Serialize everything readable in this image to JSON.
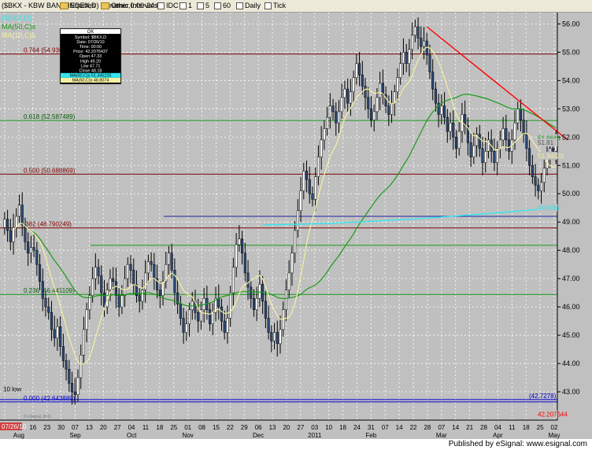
{
  "toolbar": {
    "symbol": "($BKX - KBW BANK INDEX,D) Dynamic,0:00-24:00",
    "items": [
      "Equities",
      "Other Intervals",
      "IDC",
      "1",
      "5",
      "60",
      "Daily",
      "Tick"
    ]
  },
  "footer": {
    "published": "Published by eSignal: www.esignal.com"
  },
  "colors": {
    "background": "#c0c0c0",
    "up": "#ffffff",
    "down": "#2a4a7a",
    "ma10": "#f5f0a0",
    "ma50": "#1a9a1a",
    "ma200": "#33e6f0",
    "trend": "#ff0000",
    "fib": "#800000",
    "grid": "#ffffff",
    "price": "#ffffff"
  },
  "legend": {
    "header": "($BKX,D)",
    "ma_lines": [
      "MA(50,C)s",
      "MA(10,C)s"
    ]
  },
  "info_box": {
    "title": "OK",
    "rows": [
      "Symbol: $BKX,D",
      "Date: 07/26/10",
      "Time: 00:00",
      "Price: 42.2076437",
      "Open 47.33",
      "High 49.20",
      "Low 47.71",
      "Close 48.18",
      "MA(50,C)s 51.345225",
      "MA(50,C)s 48.8074"
    ]
  },
  "chart_data": {
    "type": "candlestick",
    "title": "($BKX - KBW BANK INDEX,D) Dynamic,0:00-24:00",
    "ylim": [
      42,
      56.4
    ],
    "yticks": [
      "56.00",
      "55.00",
      "54.00",
      "53.00",
      "52.00",
      "51.00",
      "50.00",
      "49.00",
      "48.00",
      "47.00",
      "46.00",
      "45.00",
      "44.00",
      "43.00"
    ],
    "x_day_labels": [
      "26",
      "09",
      "16",
      "23",
      "30",
      "07",
      "13",
      "20",
      "27",
      "04",
      "11",
      "18",
      "25",
      "01",
      "08",
      "15",
      "22",
      "29",
      "06",
      "13",
      "20",
      "27",
      "03",
      "10",
      "18",
      "24",
      "31",
      "07",
      "14",
      "22",
      "28",
      "07",
      "14",
      "21",
      "28",
      "04",
      "11",
      "18",
      "25",
      "02"
    ],
    "x_date_label": "07/26/10",
    "x_month_labels": [
      "Aug",
      "Sep",
      "Oct",
      "Nov",
      "Dec",
      "2011",
      "Feb",
      "Mar",
      "Apr",
      "May"
    ],
    "fib_levels": [
      {
        "label": "0.764 (54.936",
        "price": 54.936,
        "color": "#800000"
      },
      {
        "label": "0.618 (52.587489)",
        "price": 52.587,
        "color": "#1a9a1a"
      },
      {
        "label": "0.500 (50.688869)",
        "price": 50.689,
        "color": "#800000"
      },
      {
        "label": ".382 (48.790249)",
        "price": 48.79,
        "color": "#800000"
      },
      {
        "label": "0.236 (46.441109)",
        "price": 46.441,
        "color": "#1a9a1a"
      },
      {
        "label": "0.000 (42.643889)",
        "price": 42.644,
        "color": "#0000cc"
      }
    ],
    "support_lines": [
      {
        "price": 48.18,
        "color": "#1a9a1a"
      },
      {
        "price": 49.2,
        "color": "#2222aa"
      },
      {
        "price": 42.7278,
        "color": "#0000cc",
        "label": "(42.7278)"
      }
    ],
    "right_labels": [
      {
        "text": "51.9644",
        "price": 51.96,
        "color": "#1a9a1a"
      },
      {
        "text": "51.81",
        "price": 51.81,
        "color": "#555555"
      },
      {
        "text": "51.34522",
        "price": 51.345,
        "color": "#f5f0a0"
      },
      {
        "text": "49.5067",
        "price": 49.51,
        "color": "#33e6f0"
      },
      {
        "text": "42.207644",
        "price": 42.207,
        "color": "#ff0000"
      }
    ],
    "annotation_low": "10 low",
    "trendline": {
      "from": {
        "bar": 144,
        "price": 55.9
      },
      "to": {
        "bar": 200,
        "price": 51.9
      }
    },
    "closes": [
      49.1,
      48.7,
      48.3,
      48.8,
      49.2,
      49.6,
      48.9,
      48.3,
      47.9,
      48.1,
      48.0,
      47.5,
      46.9,
      46.3,
      46.0,
      45.8,
      45.2,
      44.9,
      45.3,
      44.6,
      44.1,
      43.8,
      43.3,
      43.0,
      42.9,
      43.5,
      44.3,
      45.2,
      45.9,
      46.4,
      47.0,
      47.4,
      47.1,
      46.5,
      46.0,
      46.6,
      47.0,
      46.9,
      46.4,
      46.0,
      46.4,
      47.0,
      47.5,
      47.3,
      46.8,
      46.4,
      46.2,
      46.6,
      47.2,
      47.6,
      47.5,
      47.0,
      46.6,
      46.4,
      46.9,
      47.5,
      47.9,
      47.3,
      46.5,
      46.1,
      45.6,
      45.1,
      45.4,
      45.9,
      46.2,
      45.8,
      45.5,
      45.9,
      46.3,
      45.9,
      45.4,
      45.8,
      46.3,
      46.0,
      45.5,
      45.1,
      45.6,
      46.5,
      47.4,
      48.2,
      48.4,
      47.9,
      47.2,
      46.7,
      46.3,
      45.9,
      46.3,
      46.8,
      46.2,
      45.6,
      45.1,
      44.8,
      45.1,
      44.7,
      45.2,
      45.9,
      46.6,
      47.2,
      47.9,
      48.7,
      49.4,
      50.1,
      50.8,
      50.5,
      50.0,
      49.8,
      50.6,
      51.3,
      51.9,
      52.3,
      52.7,
      53.1,
      52.9,
      52.5,
      52.9,
      53.4,
      53.7,
      53.2,
      53.6,
      54.1,
      54.6,
      54.2,
      53.8,
      53.4,
      53.0,
      52.6,
      52.9,
      53.4,
      53.9,
      53.5,
      53.1,
      52.8,
      53.2,
      53.6,
      54.1,
      54.6,
      55.0,
      54.6,
      55.1,
      55.6,
      55.9,
      55.5,
      55.2,
      55.4,
      54.9,
      54.3,
      53.7,
      53.2,
      52.8,
      53.1,
      52.7,
      52.2,
      52.5,
      52.0,
      51.6,
      52.2,
      52.8,
      52.4,
      51.8,
      51.3,
      51.7,
      52.1,
      51.6,
      51.1,
      51.5,
      51.9,
      51.5,
      51.1,
      51.6,
      51.9,
      52.3,
      51.9,
      51.5,
      51.9,
      52.5,
      53.0,
      52.6,
      52.1,
      51.6,
      51.0,
      50.6,
      50.3,
      50.1,
      50.4,
      50.9,
      51.3,
      51.6,
      51.5,
      51.81
    ],
    "ma10_last": 51.34522,
    "ma50_last": 51.9644,
    "ma200_last": 49.5067
  }
}
